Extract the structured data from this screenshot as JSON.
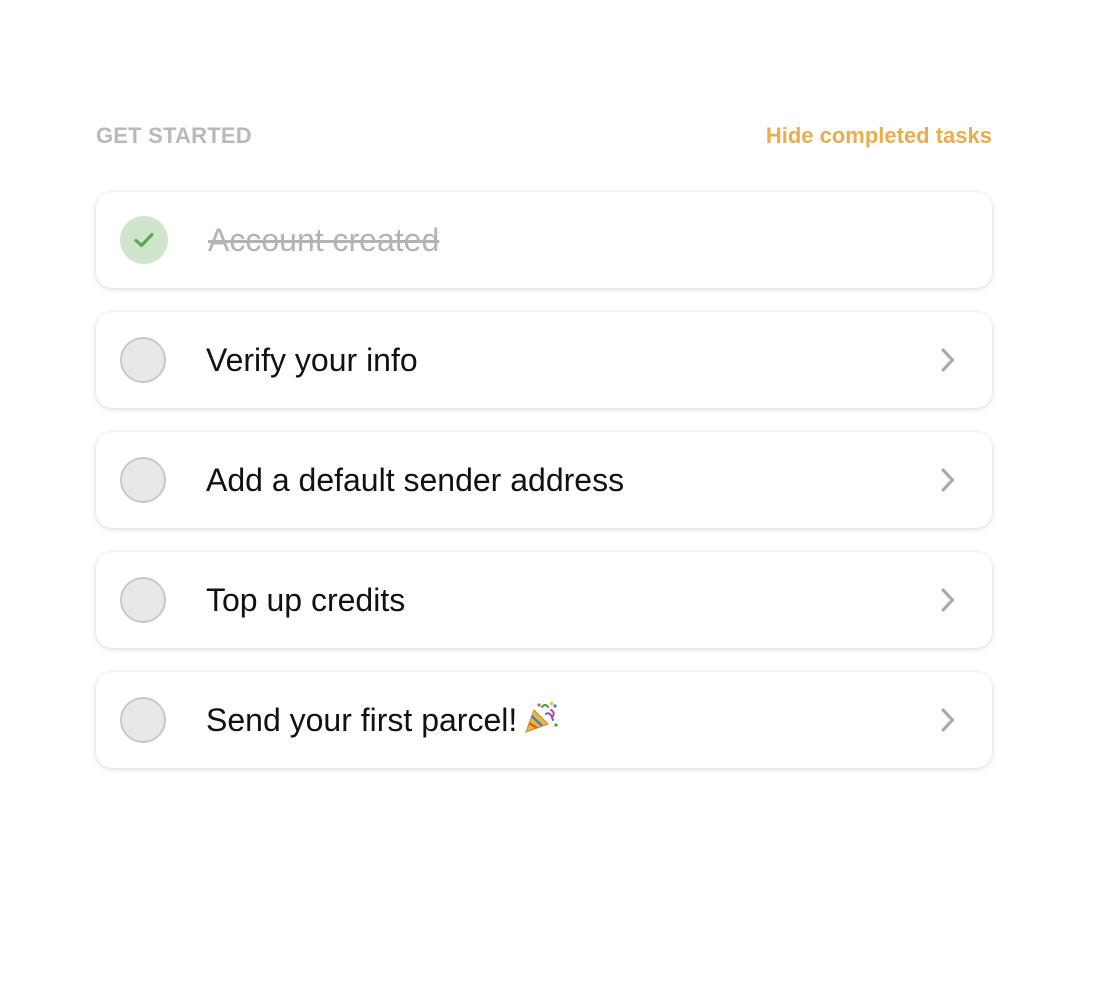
{
  "header": {
    "title": "GET STARTED",
    "hide_link": "Hide completed tasks"
  },
  "colors": {
    "accent": "#e9ad4b",
    "completed_circle": "#cfe6cc",
    "check": "#5fa85b",
    "pending_circle": "#e8e8e8",
    "muted_text": "#b3b3b3"
  },
  "tasks": [
    {
      "label": "Account created",
      "completed": true
    },
    {
      "label": "Verify your info",
      "completed": false
    },
    {
      "label": "Add a default sender address",
      "completed": false
    },
    {
      "label": "Top up credits",
      "completed": false
    },
    {
      "label": "Send your first parcel!",
      "completed": false,
      "icon": "party-popper-icon"
    }
  ]
}
